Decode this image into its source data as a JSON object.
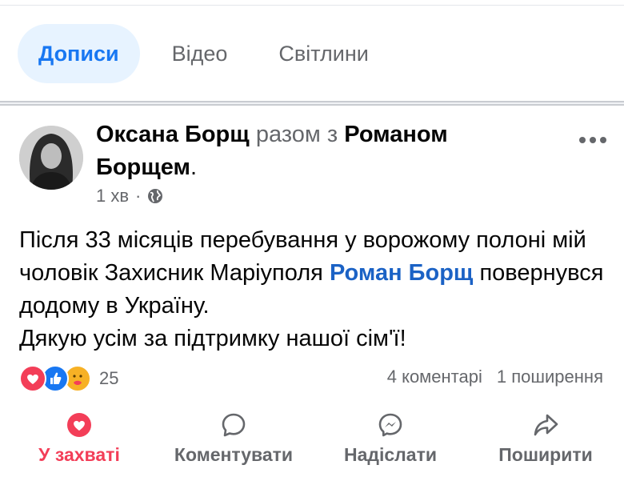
{
  "tabs": [
    {
      "label": "Дописи",
      "active": true
    },
    {
      "label": "Відео",
      "active": false
    },
    {
      "label": "Світлини",
      "active": false
    }
  ],
  "post": {
    "author_name": "Оксана Борщ",
    "with_text": "разом з",
    "tagged_name": "Романом Борщем",
    "period": ".",
    "time": "1 хв",
    "time_separator": "·",
    "privacy_icon": "globe-icon",
    "body_part1": "Після 33 місяців перебування у ворожому полоні мій чоловік Захисник Маріуполя ",
    "body_link": "Роман Борщ",
    "body_part2": " повернувся додому в Україну.",
    "body_line2": "Дякую усім за підтримку нашої сім'ї!",
    "more_icon": "more-horizontal-icon"
  },
  "reactions": {
    "icons": [
      "love-reaction-icon",
      "like-reaction-icon",
      "care-reaction-icon"
    ],
    "count": "25"
  },
  "stats": {
    "comments": "4 коментарі",
    "shares": "1 поширення"
  },
  "actions": {
    "react_label": "У захваті",
    "comment_label": "Коментувати",
    "send_label": "Надіслати",
    "share_label": "Поширити"
  },
  "colors": {
    "accent": "#1877f2",
    "link": "#1b62c5",
    "love": "#f33e58",
    "secondary_text": "#65676b",
    "active_tab_bg": "#e7f3ff"
  }
}
